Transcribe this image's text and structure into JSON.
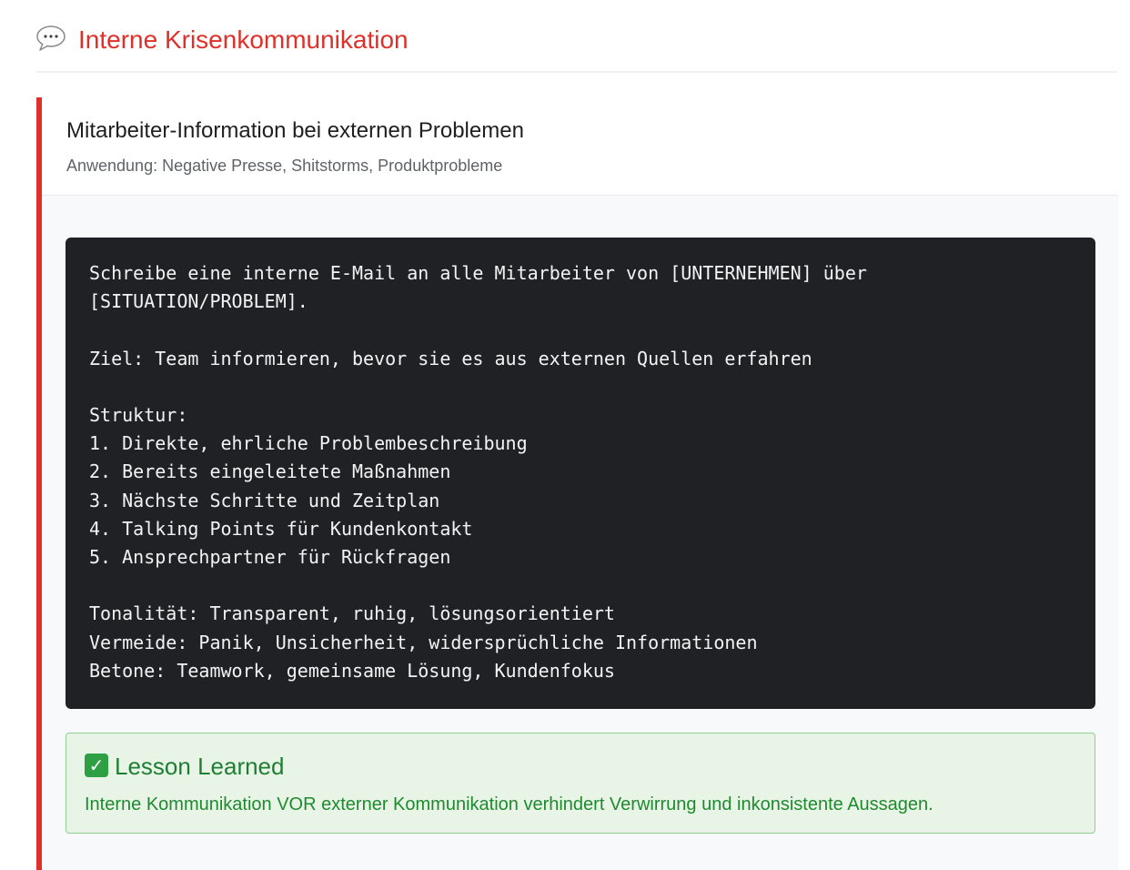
{
  "header": {
    "icon": "speech-bubble-icon",
    "title": "Interne Krisenkommunikation",
    "accent_color": "#e0302a"
  },
  "card": {
    "title": "Mitarbeiter-Information bei externen Problemen",
    "subtitle": "Anwendung: Negative Presse, Shitstorms, Produktprobleme",
    "prompt": "Schreibe eine interne E-Mail an alle Mitarbeiter von [UNTERNEHMEN] über\n[SITUATION/PROBLEM].\n\nZiel: Team informieren, bevor sie es aus externen Quellen erfahren\n\nStruktur:\n1. Direkte, ehrliche Problembeschreibung\n2. Bereits eingeleitete Maßnahmen\n3. Nächste Schritte und Zeitplan\n4. Talking Points für Kundenkontakt\n5. Ansprechpartner für Rückfragen\n\nTonalität: Transparent, ruhig, lösungsorientiert\nVermeide: Panik, Unsicherheit, widersprüchliche Informationen\nBetone: Teamwork, gemeinsame Lösung, Kundenfokus"
  },
  "lesson": {
    "icon": "check-mark-icon",
    "title": "Lesson Learned",
    "text": "Interne Kommunikation VOR externer Kommunikation verhindert Verwirrung und inkonsistente Aussagen.",
    "color": "#1e7e34"
  }
}
